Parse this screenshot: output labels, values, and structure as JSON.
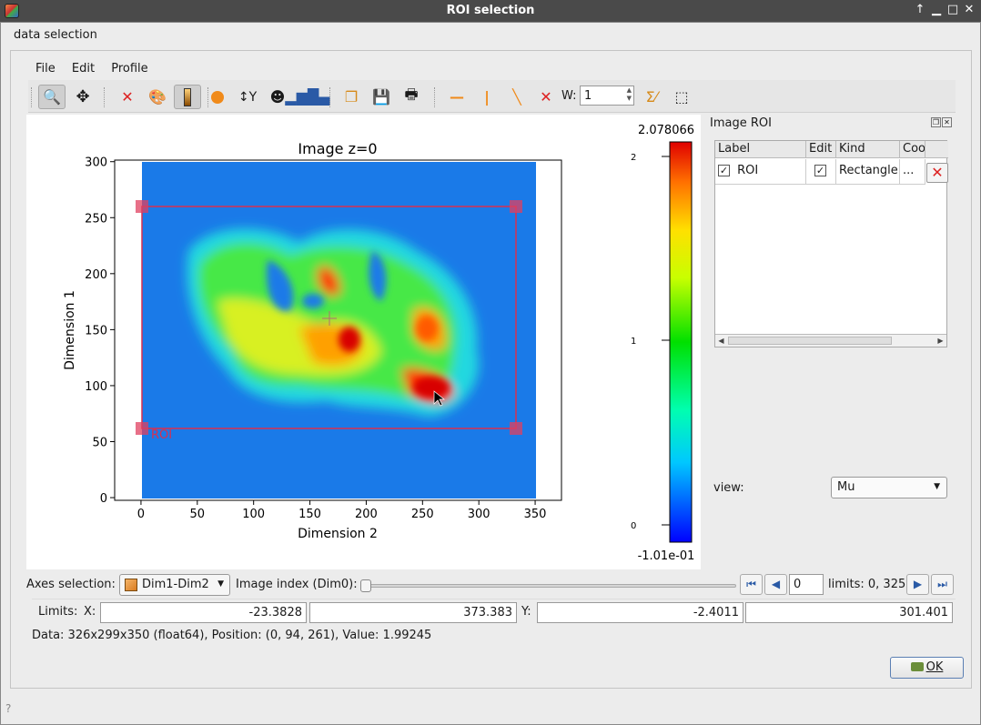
{
  "window": {
    "title": "ROI selection"
  },
  "menubar": {
    "data_selection": "data selection"
  },
  "inner_menu": {
    "file": "File",
    "edit": "Edit",
    "profile": "Profile"
  },
  "toolbar": {
    "width_label": "W:",
    "width_value": "1"
  },
  "plot": {
    "title": "Image z=0",
    "xlabel": "Dimension 2",
    "ylabel": "Dimension 1",
    "xticks": [
      "0",
      "50",
      "100",
      "150",
      "200",
      "250",
      "300",
      "350"
    ],
    "yticks": [
      "0",
      "50",
      "100",
      "150",
      "200",
      "250",
      "300"
    ],
    "roi_label": "ROI"
  },
  "colorbar": {
    "max_label": "2.078066",
    "min_label": "-1.01e-01",
    "ticks": [
      "2",
      "1",
      "0"
    ]
  },
  "chart_data": {
    "type": "heatmap",
    "title": "Image z=0",
    "xlabel": "Dimension 2",
    "ylabel": "Dimension 1",
    "xlim": [
      -23.3828,
      373.383
    ],
    "ylim": [
      -2.4011,
      301.401
    ],
    "colormap_range": [
      -0.101,
      2.078066
    ],
    "roi": {
      "kind": "Rectangle",
      "x": [
        0,
        333
      ],
      "y": [
        63,
        261
      ]
    }
  },
  "roi_panel": {
    "title": "Image ROI",
    "columns": [
      "Label",
      "Edit",
      "Kind",
      "Coo"
    ],
    "row": {
      "label": "ROI",
      "kind": "Rectangle",
      "coords": "..."
    },
    "view_label": "view:",
    "view_value": "Mu"
  },
  "axes": {
    "label": "Axes selection:",
    "value": "Dim1-Dim2",
    "image_index_label": "Image index (Dim0):",
    "frame_value": "0",
    "limits_text": "limits: 0, 325"
  },
  "limits": {
    "label": "Limits:",
    "x_label": "X:",
    "x_min": "-23.3828",
    "x_max": "373.383",
    "y_label": "Y:",
    "y_min": "-2.4011",
    "y_max": "301.401"
  },
  "status": {
    "text": "Data: 326x299x350 (float64), Position: (0, 94, 261), Value: 1.99245"
  },
  "ok_button": {
    "label": "OK"
  }
}
